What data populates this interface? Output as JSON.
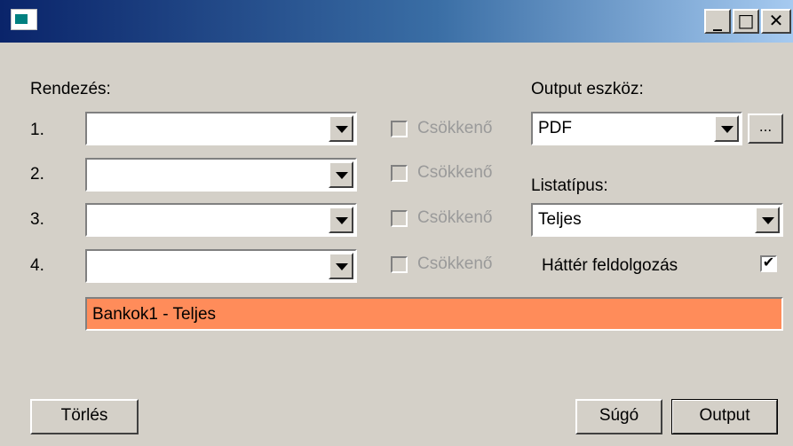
{
  "window": {
    "controls": {
      "minimize": "_",
      "maximize": "□",
      "close": "✕"
    }
  },
  "sort": {
    "heading": "Rendezés:",
    "rows": [
      {
        "index": "1.",
        "value": "",
        "desc_label": "Csökkenő",
        "desc_checked": false
      },
      {
        "index": "2.",
        "value": "",
        "desc_label": "Csökkenő",
        "desc_checked": false
      },
      {
        "index": "3.",
        "value": "",
        "desc_label": "Csökkenő",
        "desc_checked": false
      },
      {
        "index": "4.",
        "value": "",
        "desc_label": "Csökkenő",
        "desc_checked": false
      }
    ]
  },
  "output": {
    "device_label": "Output eszköz:",
    "device_value": "PDF",
    "browse_label": "...",
    "list_type_label": "Listatípus:",
    "list_type_value": "Teljes",
    "background_label": "Háttér feldolgozás",
    "background_checked": true
  },
  "report_title": "Bankok1 - Teljes",
  "buttons": {
    "clear": "Törlés",
    "help": "Súgó",
    "output": "Output"
  },
  "colors": {
    "title_field_bg": "#ff8c5a",
    "window_bg": "#d4d0c8"
  }
}
